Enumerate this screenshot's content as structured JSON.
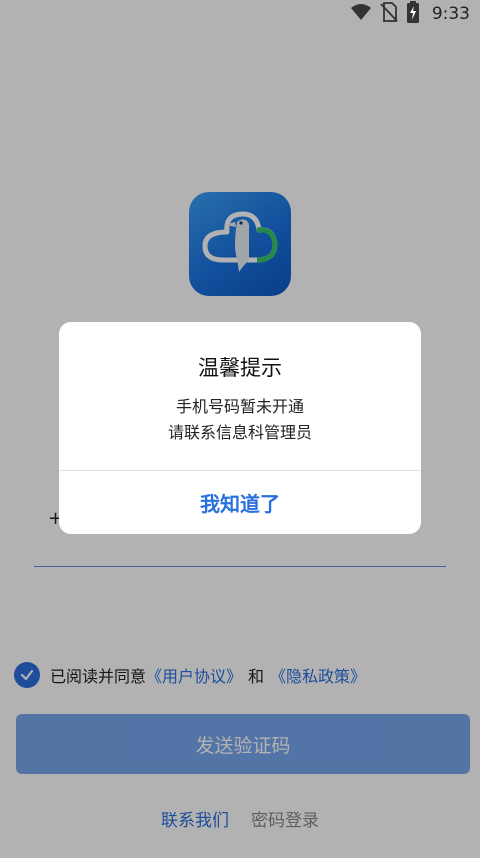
{
  "status_bar": {
    "time": "9:33",
    "icons": [
      "wifi-icon",
      "no-sim-icon",
      "battery-charging-icon"
    ]
  },
  "app": {
    "logo_icon": "woodpecker-cloud-logo",
    "brand_color": "#1a72e0"
  },
  "login": {
    "phone_prefix": "+",
    "agreement": {
      "prefix": "已阅读并同意",
      "user_agreement": "《用户协议》",
      "and": "和",
      "privacy_policy": "《隐私政策》",
      "checked": true
    },
    "send_code_label": "发送验证码",
    "contact_us_label": "联系我们",
    "password_login_label": "密码登录"
  },
  "dialog": {
    "title": "温馨提示",
    "message_line1": "手机号码暂未开通",
    "message_line2": "请联系信息科管理员",
    "confirm_label": "我知道了"
  },
  "colors": {
    "accent": "#2a6fde",
    "overlay": "rgba(0,0,0,0.30)"
  }
}
